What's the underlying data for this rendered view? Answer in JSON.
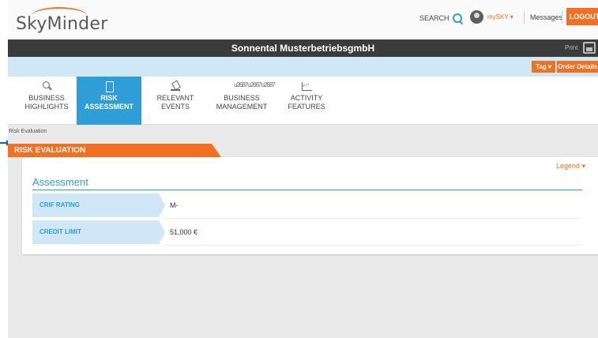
{
  "header": {
    "logo_text": "SkyMinder",
    "search_label": "SEARCH",
    "account_label": "mySKY ▾",
    "messages_label": "Messages",
    "logout_label": "LOGOUT"
  },
  "company_bar": {
    "company_name": "Sonnental MusterbetriebsgmbH",
    "print_label": "Print"
  },
  "action_buttons": {
    "tag_label": "Tag ▾",
    "order_details_label": "Order Details ▾"
  },
  "tabs": [
    {
      "label": "BUSINESS\nHIGHLIGHTS",
      "icon": "magnifier-icon",
      "active": false
    },
    {
      "label": "RISK\nASSESSMENT",
      "icon": "document-icon",
      "active": true
    },
    {
      "label": "RELEVANT\nEVENTS",
      "icon": "gavel-icon",
      "active": false
    },
    {
      "label": "BUSINESS\nMANAGEMENT",
      "icon": "people-icon",
      "active": false
    },
    {
      "label": "ACTIVITY\nFEATURES",
      "icon": "chart-icon",
      "active": false
    }
  ],
  "breadcrumb": "Risk Evaluation",
  "section": {
    "title": "RISK EVALUATION",
    "legend_label": "Legend ▾",
    "assessment_title": "Assessment",
    "rows": [
      {
        "label": "CRIF RATING",
        "value": "M-"
      },
      {
        "label": "CREDIT LIMIT",
        "value": "51,000 €"
      }
    ]
  },
  "colors": {
    "accent_orange": "#f37021",
    "accent_blue": "#2f9ed8",
    "dark_bar": "#3b3b3b",
    "light_blue": "#cfe7f6"
  }
}
